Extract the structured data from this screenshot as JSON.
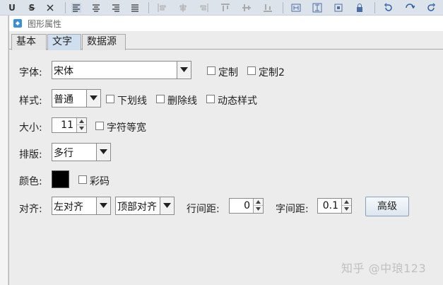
{
  "toolbar": {
    "underline_label": "U",
    "strike_label": "S"
  },
  "dialog": {
    "title": "图形属性"
  },
  "tabs": [
    {
      "label": "基本"
    },
    {
      "label": "文字"
    },
    {
      "label": "数据源"
    }
  ],
  "font": {
    "label": "字体:",
    "value": "宋体",
    "custom_label": "定制",
    "custom2_label": "定制2"
  },
  "style": {
    "label": "样式:",
    "value": "普通",
    "underline_label": "下划线",
    "strikethrough_label": "删除线",
    "dynamic_label": "动态样式"
  },
  "size": {
    "label": "大小:",
    "value": "11",
    "equal_width_label": "字符等宽"
  },
  "layout": {
    "label": "排版:",
    "value": "多行"
  },
  "color": {
    "label": "颜色:",
    "swatch": "#000000",
    "colorful_label": "彩码"
  },
  "align": {
    "label": "对齐:",
    "horizontal": "左对齐",
    "vertical": "顶部对齐",
    "line_spacing_label": "行间距:",
    "line_spacing_value": "0",
    "char_spacing_label": "字间距:",
    "char_spacing_value": "0.1",
    "advanced_label": "高级"
  },
  "watermark": "知乎 @中琅123"
}
